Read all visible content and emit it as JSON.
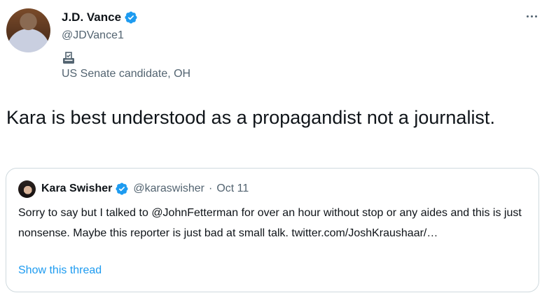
{
  "author": {
    "name": "J.D. Vance",
    "handle": "@JDVance1",
    "affiliation": "US Senate candidate, OH",
    "verified": true
  },
  "tweet": {
    "text": "Kara is best understood as a propagandist not a journalist."
  },
  "quote": {
    "name": "Kara Swisher",
    "handle": "@karaswisher",
    "separator": "·",
    "date": "Oct 11",
    "verified": true,
    "text": "Sorry to say but I talked to @JohnFetterman for over an hour without stop or any aides and this is just nonsense. Maybe this reporter is just bad at small talk. twitter.com/JoshKraushaar/…",
    "show_thread_label": "Show this thread"
  },
  "colors": {
    "verified": "#1d9bf0",
    "link": "#1d9bf0",
    "secondary_text": "#536471",
    "border": "#cfd9de"
  },
  "icons": {
    "more": "ellipsis-icon",
    "ballot": "ballot-box-icon",
    "verified": "verified-badge-icon"
  }
}
